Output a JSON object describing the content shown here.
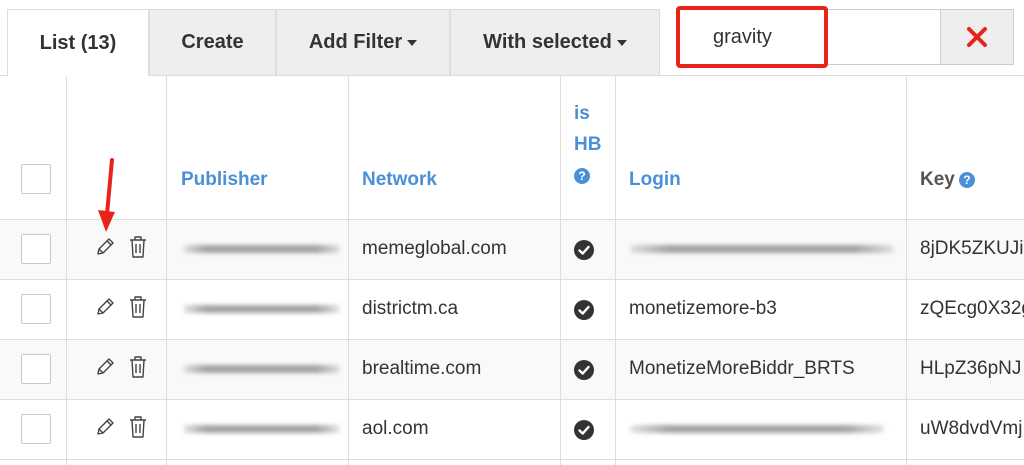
{
  "toolbar": {
    "tabs": [
      "List (13)",
      "Create",
      "Add Filter",
      "With selected"
    ],
    "search_value": "gravity",
    "clear_icon": "close-x-icon",
    "clear_color": "#e8231c"
  },
  "table": {
    "headers": {
      "publisher": "Publisher",
      "network": "Network",
      "is_hb_line1": "is",
      "is_hb_line2": "HB",
      "login": "Login",
      "key": "Key"
    },
    "rows": [
      {
        "network": "memeglobal.com",
        "login": "",
        "key": "8jDK5ZKUJi"
      },
      {
        "network": "districtm.ca",
        "login": "monetizemore-b3",
        "key": "zQEcg0X32g"
      },
      {
        "network": "brealtime.com",
        "login": "MonetizeMoreBiddr_BRTS",
        "key": "HLpZ36pNJ"
      },
      {
        "network": "aol.com",
        "login": "",
        "key": "uW8dvdVmj"
      }
    ]
  },
  "colors": {
    "header_link": "#4a90d9",
    "annotation": "#e8231c"
  }
}
